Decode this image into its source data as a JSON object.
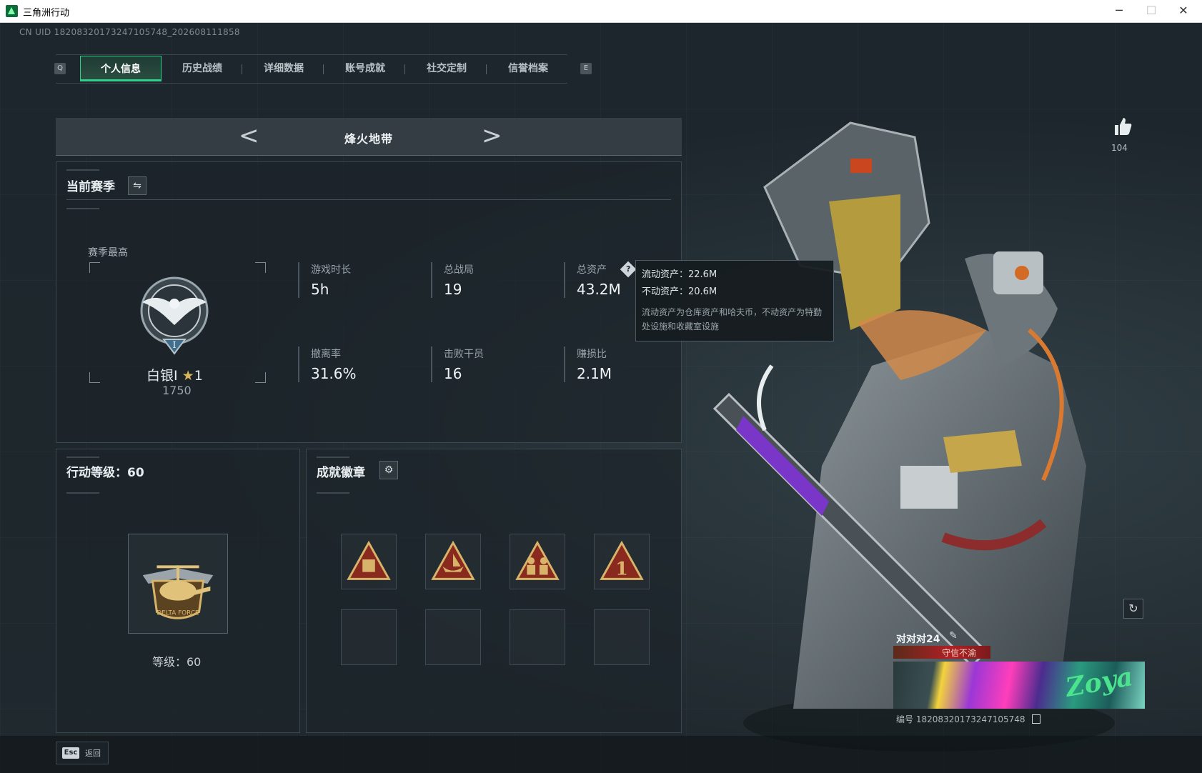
{
  "window": {
    "title": "三角洲行动",
    "minimize": "─",
    "maximize": "☐",
    "close": "✕"
  },
  "uid_line": "CN UID 182083201732471057​48_202608111858",
  "tabs": {
    "left_key": "Q",
    "right_key": "E",
    "items": [
      {
        "label": "个人信息",
        "active": true
      },
      {
        "label": "历史战绩",
        "active": false
      },
      {
        "label": "详细数据",
        "active": false
      },
      {
        "label": "账号成就",
        "active": false
      },
      {
        "label": "社交定制",
        "active": false
      },
      {
        "label": "信誉档案",
        "active": false
      }
    ]
  },
  "mode": {
    "title": "烽火地带",
    "prev": "<",
    "next": ">"
  },
  "season": {
    "header": "当前赛季",
    "swap_icon": "⇋",
    "best_label": "赛季最高",
    "rank_name": "白银I",
    "rank_stars": "1",
    "rank_score": "1750",
    "stats": [
      {
        "label": "游戏时长",
        "value": "5h"
      },
      {
        "label": "总战局",
        "value": "19"
      },
      {
        "label": "总资产",
        "value": "43.2M"
      },
      {
        "label": "撤离率",
        "value": "31.6%"
      },
      {
        "label": "击败干员",
        "value": "16"
      },
      {
        "label": "赚损比",
        "value": "2.1M"
      }
    ],
    "help": "?"
  },
  "tooltip": {
    "liquid": "流动资产：22.6M",
    "fixed": "不动资产：20.6M",
    "note": "流动资产为仓库资产和哈夫币，不动资产为特勤处设施和收藏室设施"
  },
  "level": {
    "header": "行动等级：60",
    "label": "等级：60"
  },
  "badges": {
    "header": "成就徽章",
    "gear_icon": "⚙",
    "slots_filled": 4,
    "slots_empty": 4
  },
  "likes": {
    "count": "104"
  },
  "refresh_icon": "↻",
  "card": {
    "name": "对对对24",
    "edit_icon": "✎",
    "title": "守信不渝",
    "banner_text": "Zoya",
    "id_line": "编号 182083201732471057​48"
  },
  "bottom": {
    "esc_key": "Esc",
    "esc_label": "返回"
  },
  "colors": {
    "accent": "#2fd18a",
    "gold": "#d8b46a",
    "badge_red": "#8a2a1e"
  }
}
